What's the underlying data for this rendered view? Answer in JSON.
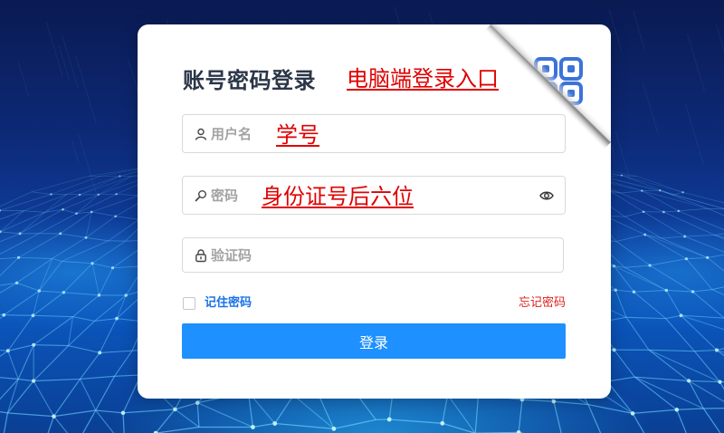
{
  "login_card": {
    "title": "账号密码登录",
    "qr_switch": {
      "icon": "qr-code-icon"
    },
    "username": {
      "icon": "user-icon",
      "placeholder": "用户名"
    },
    "password": {
      "icon": "key-icon",
      "placeholder": "密码",
      "toggle_icon": "eye-icon"
    },
    "captcha": {
      "icon": "lock-icon",
      "placeholder": "验证码"
    },
    "remember_me": {
      "label": "记住密码",
      "checked": false
    },
    "forgot_password_label": "忘记密码",
    "submit_label": "登录"
  },
  "annotations": {
    "qr_note": "电脑端登录入口",
    "username_note": "学号",
    "password_note": "身份证号后六位"
  },
  "colors": {
    "primary": "#1e90ff",
    "title": "#2b3648",
    "link": "#1a73e8",
    "danger": "#e0201c",
    "annotation": "#e00000",
    "qr": "#3b73d8",
    "bg_top": "#0a1a52",
    "bg_bottom": "#0b55bb"
  }
}
